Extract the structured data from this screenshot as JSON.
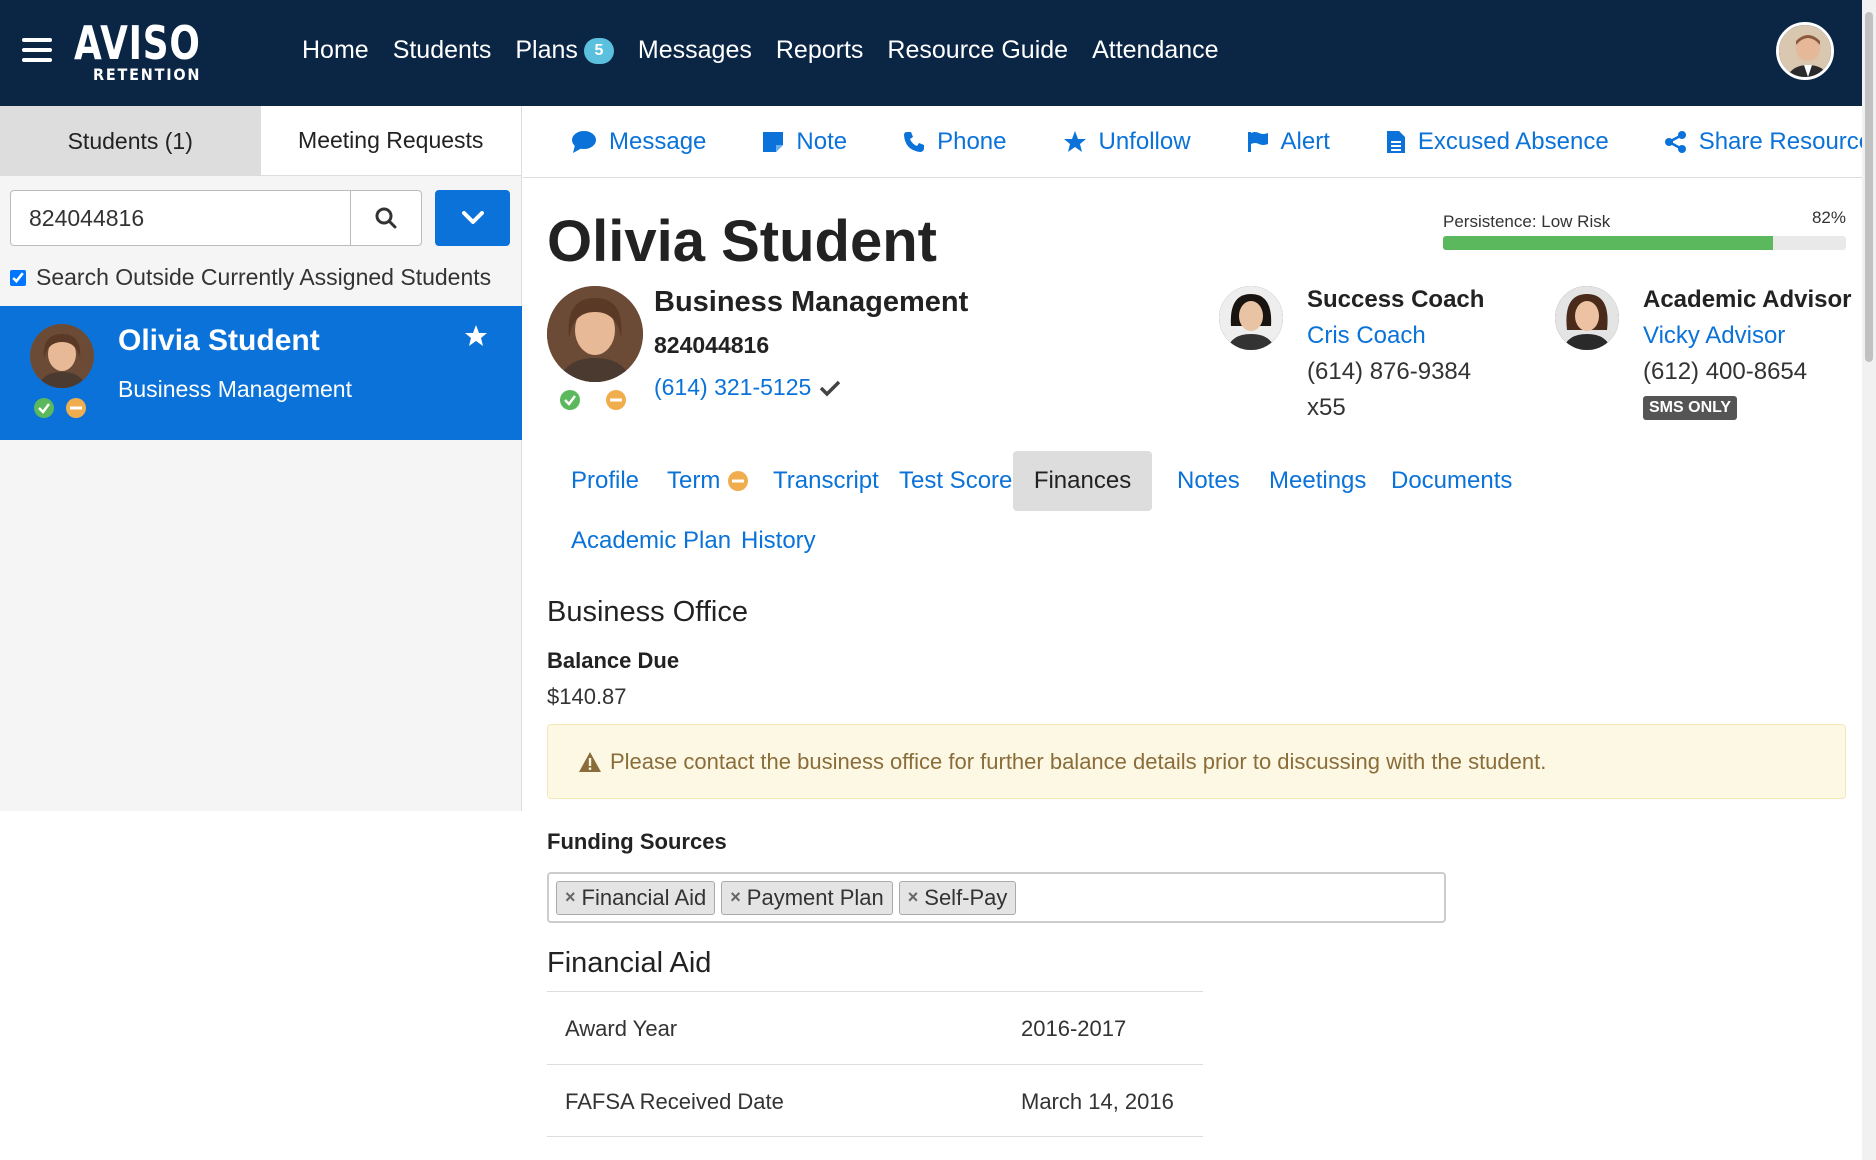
{
  "app": {
    "logo_big": "AVISO",
    "logo_small": "RETENTION"
  },
  "nav": {
    "home": "Home",
    "students": "Students",
    "plans": "Plans",
    "plans_badge": "5",
    "messages": "Messages",
    "reports": "Reports",
    "resource_guide": "Resource Guide",
    "attendance": "Attendance"
  },
  "left": {
    "tab_students": "Students (1)",
    "tab_meeting_requests": "Meeting Requests",
    "search_value": "824044816",
    "outside_label": "Search Outside Currently Assigned Students",
    "outside_checked": true,
    "card": {
      "name": "Olivia Student",
      "program": "Business Management"
    }
  },
  "actions": {
    "message": "Message",
    "note": "Note",
    "phone": "Phone",
    "unfollow": "Unfollow",
    "alert": "Alert",
    "excused_absence": "Excused Absence",
    "share_resource": "Share Resource"
  },
  "student": {
    "name": "Olivia Student",
    "program": "Business Management",
    "id": "824044816",
    "phone": "(614) 321-5125",
    "persistence_label": "Persistence: Low Risk",
    "persistence_pct_text": "82%",
    "persistence_value": 0.82
  },
  "success_coach": {
    "title": "Success Coach",
    "name": "Cris Coach",
    "phone": "(614) 876-9384",
    "ext": "x55"
  },
  "academic_advisor": {
    "title": "Academic Advisor",
    "name": "Vicky Advisor",
    "phone": "(612) 400-8654",
    "sms": "SMS ONLY"
  },
  "tabs": {
    "profile": "Profile",
    "term": "Term",
    "transcript": "Transcript",
    "test_scores": "Test Scores",
    "finances": "Finances",
    "notes": "Notes",
    "meetings": "Meetings",
    "documents": "Documents",
    "academic_plan": "Academic Plan",
    "history": "History"
  },
  "finances": {
    "business_office_title": "Business Office",
    "balance_due_label": "Balance Due",
    "balance_due_value": "$140.87",
    "alert_text": "Please contact the business office for further balance details prior to discussing with the student.",
    "funding_sources_label": "Funding Sources",
    "funding_sources": [
      "Financial Aid",
      "Payment Plan",
      "Self-Pay"
    ],
    "financial_aid_title": "Financial Aid",
    "rows": [
      {
        "key": "Award Year",
        "value": "2016-2017"
      },
      {
        "key": "FAFSA Received Date",
        "value": "March 14, 2016"
      }
    ]
  },
  "colors": {
    "topbar": "#0b2545",
    "accent": "#0a72d8",
    "success": "#5cb85c",
    "warning": "#f0ad4e"
  }
}
